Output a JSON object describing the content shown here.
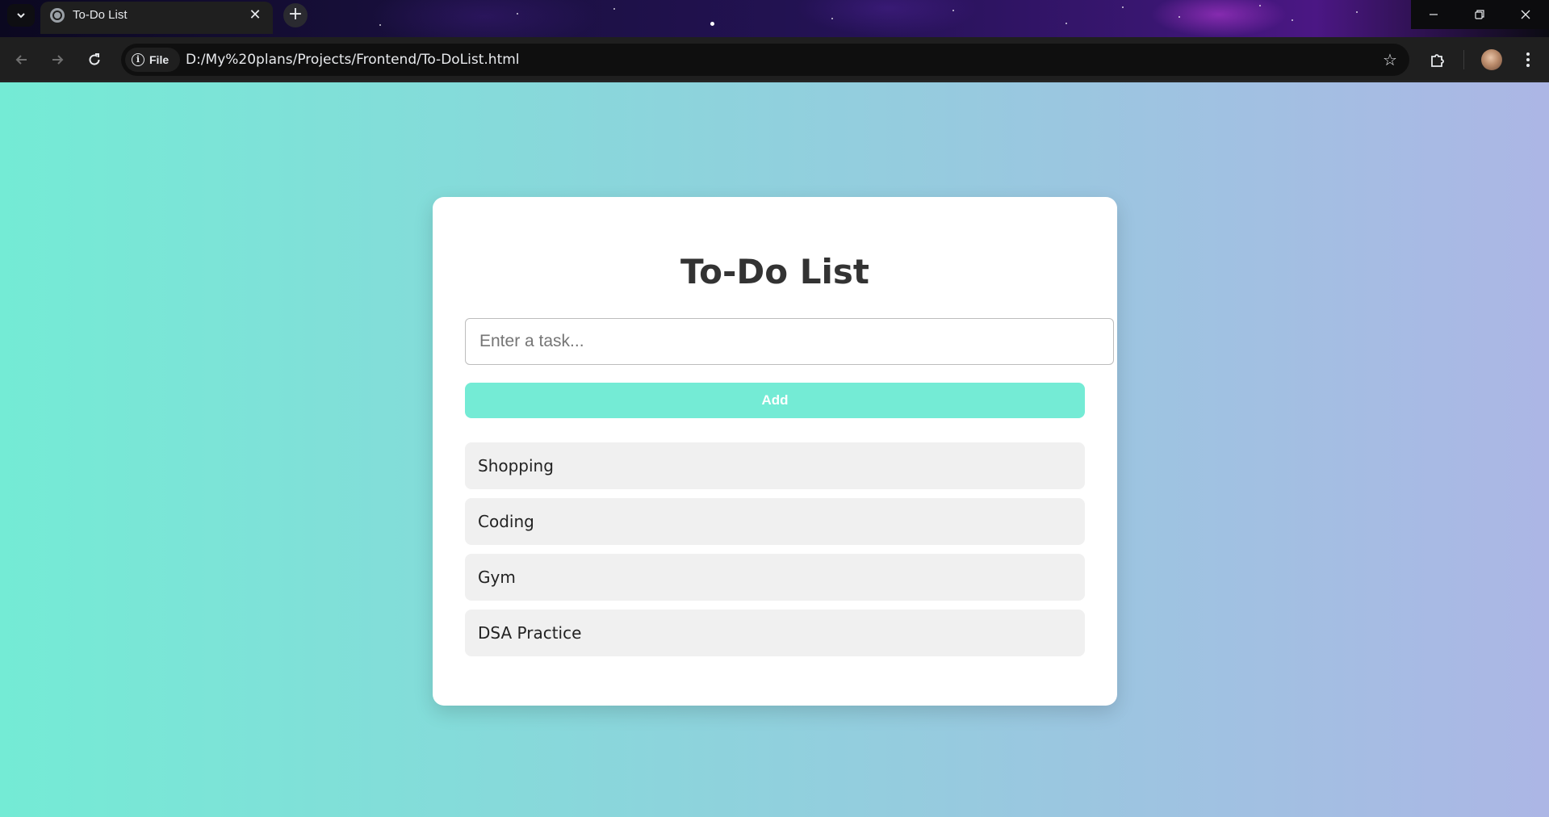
{
  "browser": {
    "tab": {
      "title": "To-Do List",
      "close_glyph": "✕",
      "favicon": "globe-icon"
    },
    "new_tab_glyph": "+",
    "omnibox": {
      "security_label": "File",
      "url": "D:/My%20plans/Projects/Frontend/To-DoList.html"
    },
    "colors": {
      "frame": "#1f1f1f",
      "omnibox": "#0f0f0f"
    }
  },
  "page": {
    "title": "To-Do List",
    "input": {
      "placeholder": "Enter a task...",
      "value": ""
    },
    "add_button_label": "Add",
    "tasks": [
      {
        "text": "Shopping"
      },
      {
        "text": "Coding"
      },
      {
        "text": "Gym"
      },
      {
        "text": "DSA Practice"
      }
    ],
    "colors": {
      "gradient_start": "#74ebd5",
      "gradient_end": "#acb6e5",
      "button": "#74ebd5",
      "item_bg": "#f0f0f0"
    }
  }
}
